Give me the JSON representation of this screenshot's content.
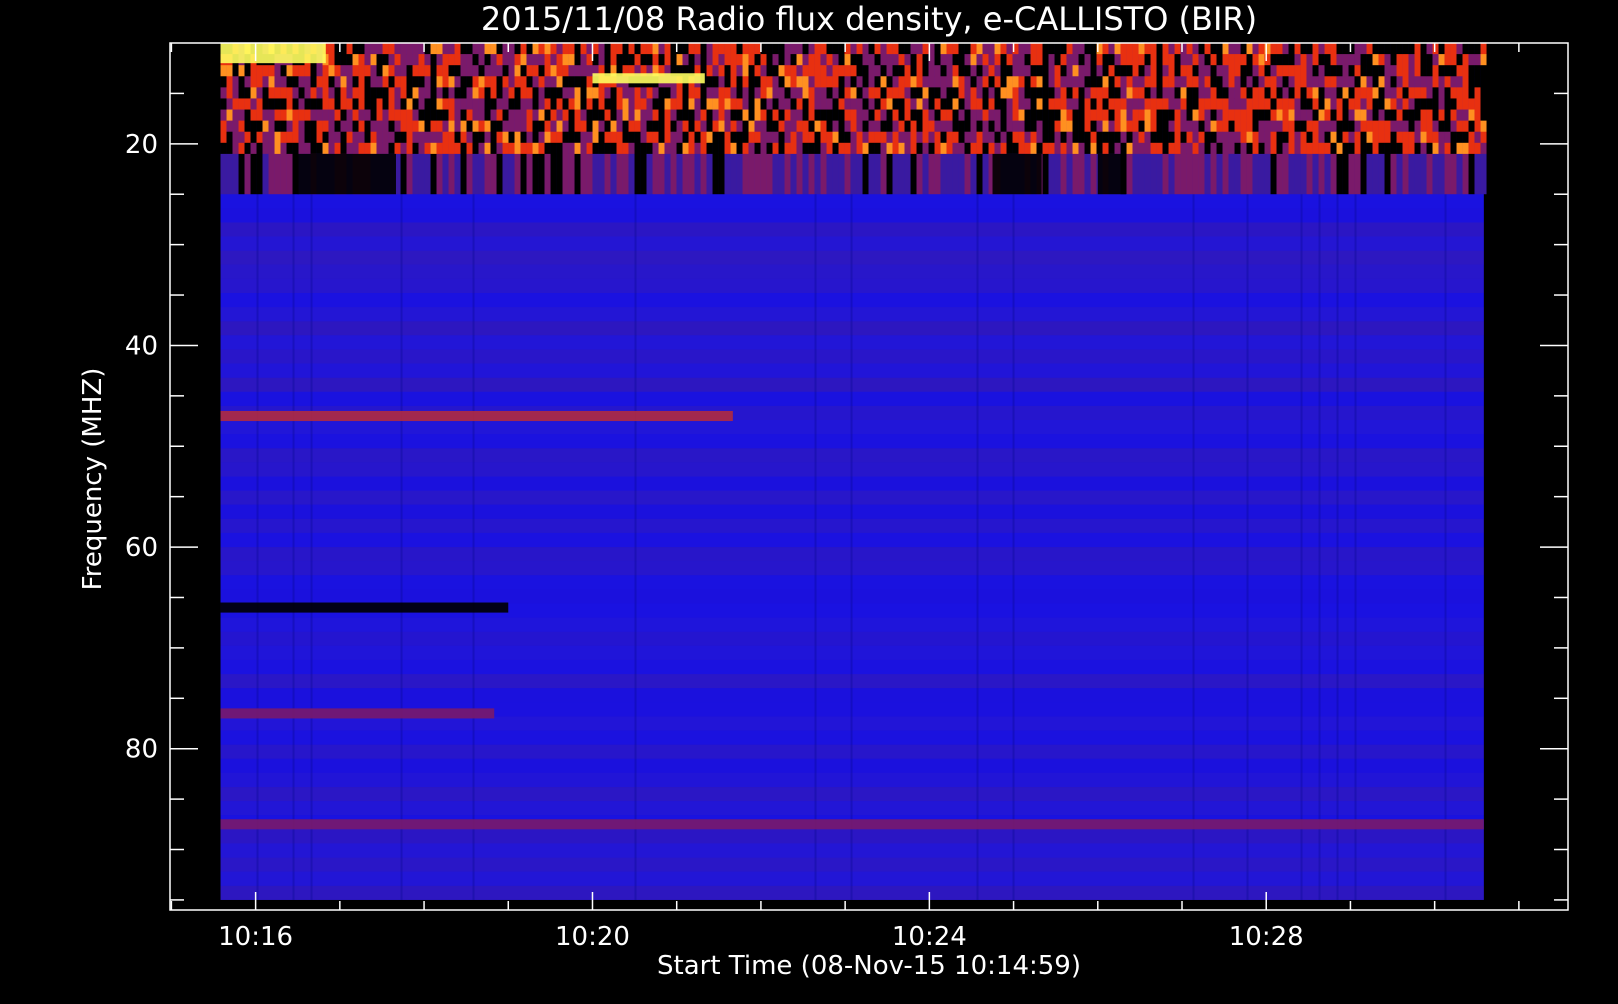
{
  "chart_data": {
    "type": "heatmap",
    "title": "2015/11/08  Radio flux density, e-CALLISTO (BIR)",
    "xlabel": "Start Time (08-Nov-15 10:14:59)",
    "ylabel": "Frequency (MHZ)",
    "x_unit": "UT time",
    "xlim": [
      "10:14:59",
      "10:31:35"
    ],
    "data_x_extent": [
      "10:15:35",
      "10:30:35"
    ],
    "ylim": [
      96,
      10
    ],
    "data_y_extent": [
      95,
      10
    ],
    "y_inverted": true,
    "x_ticks": [
      "10:16",
      "10:20",
      "10:24",
      "10:28"
    ],
    "y_ticks": [
      20,
      40,
      60,
      80
    ],
    "grid": false,
    "colormap": "black-blue-red-yellow-white",
    "colors": {
      "background": "#000000",
      "axis": "#ffffff",
      "quiet_level": "#1a14e6",
      "low": "#000000",
      "medium": "#7a1a6a",
      "high": "#e83010",
      "peak": "#ffff60"
    },
    "features": [
      {
        "description": "Strong interference band",
        "freq_range": [
          10,
          21
        ],
        "time_range": [
          "10:15:35",
          "10:30:35"
        ]
      },
      {
        "description": "Bright burst",
        "freq_range": [
          10,
          12
        ],
        "time_range": [
          "10:15:35",
          "10:16:50"
        ]
      },
      {
        "description": "Bright streak",
        "freq_range": [
          13,
          14
        ],
        "time_range": [
          "10:20:00",
          "10:21:20"
        ]
      },
      {
        "description": "Dark gaps",
        "freq_range": [
          21,
          25
        ],
        "time_range": [
          "10:16:30",
          "10:17:40"
        ]
      },
      {
        "description": "Dark gap",
        "freq_range": [
          21,
          25
        ],
        "time_range": [
          "10:24:45",
          "10:25:20"
        ]
      },
      {
        "description": "Dark gap",
        "freq_range": [
          21,
          25
        ],
        "time_range": [
          "10:26:00",
          "10:26:20"
        ]
      },
      {
        "description": "Narrowband line",
        "freq_range": [
          46.5,
          47.5
        ],
        "time_range": [
          "10:15:35",
          "10:21:40"
        ]
      },
      {
        "description": "Dark band",
        "freq_range": [
          65.5,
          66.5
        ],
        "time_range": [
          "10:15:35",
          "10:19:00"
        ]
      },
      {
        "description": "Reddish band",
        "freq_range": [
          76,
          77
        ],
        "time_range": [
          "10:15:35",
          "10:18:50"
        ]
      },
      {
        "description": "Reddish band",
        "freq_range": [
          87,
          88
        ],
        "time_range": [
          "10:15:35",
          "10:30:35"
        ]
      }
    ]
  }
}
